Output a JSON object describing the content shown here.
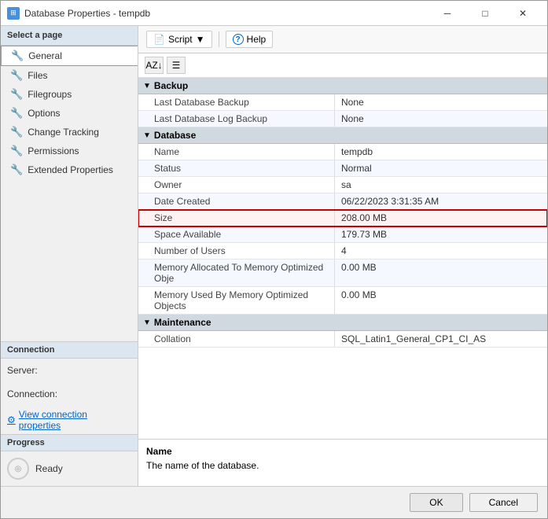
{
  "window": {
    "title": "Database Properties - tempdb",
    "icon": "db"
  },
  "titlebar": {
    "minimize": "─",
    "maximize": "□",
    "close": "✕"
  },
  "sidebar": {
    "select_page_label": "Select a page",
    "items": [
      {
        "id": "general",
        "label": "General",
        "active": true
      },
      {
        "id": "files",
        "label": "Files",
        "active": false
      },
      {
        "id": "filegroups",
        "label": "Filegroups",
        "active": false
      },
      {
        "id": "options",
        "label": "Options",
        "active": false
      },
      {
        "id": "change-tracking",
        "label": "Change Tracking",
        "active": false
      },
      {
        "id": "permissions",
        "label": "Permissions",
        "active": false
      },
      {
        "id": "extended-properties",
        "label": "Extended Properties",
        "active": false
      }
    ],
    "connection_label": "Connection",
    "server_label": "Server:",
    "server_value": "",
    "connection_label2": "Connection:",
    "connection_value": "",
    "view_connection_label": "View connection properties",
    "progress_label": "Progress",
    "status_label": "Ready"
  },
  "toolbar": {
    "script_label": "Script",
    "help_label": "Help"
  },
  "properties": {
    "sort_alpha_tooltip": "Sort alphabetically",
    "sort_cat_tooltip": "Sort by category",
    "groups": [
      {
        "name": "Backup",
        "rows": [
          {
            "label": "Last Database Backup",
            "value": "None"
          },
          {
            "label": "Last Database Log Backup",
            "value": "None"
          }
        ]
      },
      {
        "name": "Database",
        "rows": [
          {
            "label": "Name",
            "value": "tempdb"
          },
          {
            "label": "Status",
            "value": "Normal"
          },
          {
            "label": "Owner",
            "value": "sa"
          },
          {
            "label": "Date Created",
            "value": "06/22/2023 3:31:35 AM"
          },
          {
            "label": "Size",
            "value": "208.00 MB",
            "highlighted": true
          },
          {
            "label": "Space Available",
            "value": "179.73 MB"
          },
          {
            "label": "Number of Users",
            "value": "4"
          },
          {
            "label": "Memory Allocated To Memory Optimized Obje",
            "value": "0.00 MB"
          },
          {
            "label": "Memory Used By Memory Optimized Objects",
            "value": "0.00 MB"
          }
        ]
      },
      {
        "name": "Maintenance",
        "rows": [
          {
            "label": "Collation",
            "value": "SQL_Latin1_General_CP1_CI_AS"
          }
        ]
      }
    ]
  },
  "description": {
    "title": "Name",
    "text": "The name of the database."
  },
  "footer": {
    "ok_label": "OK",
    "cancel_label": "Cancel"
  }
}
